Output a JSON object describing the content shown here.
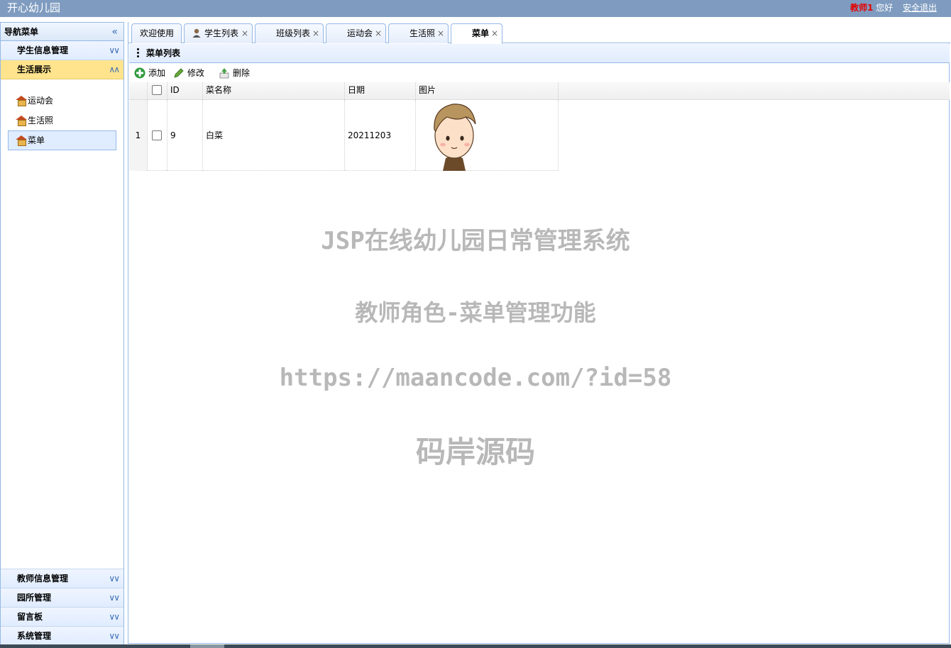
{
  "header": {
    "app_title": "开心幼儿园",
    "username": "教师1",
    "greeting": "您好",
    "logout": "安全退出"
  },
  "sidebar": {
    "title": "导航菜单",
    "groups_top": [
      {
        "label": "学生信息管理",
        "state": "collapsed"
      },
      {
        "label": "生活展示",
        "state": "expanded"
      }
    ],
    "items": [
      {
        "label": "运动会",
        "selected": false
      },
      {
        "label": "生活照",
        "selected": false
      },
      {
        "label": "菜单",
        "selected": true
      }
    ],
    "groups_bottom": [
      {
        "label": "教师信息管理"
      },
      {
        "label": "园所管理"
      },
      {
        "label": "留言板"
      },
      {
        "label": "系统管理"
      }
    ]
  },
  "tabs": [
    {
      "label": "欢迎使用",
      "closable": false,
      "icon": null
    },
    {
      "label": "学生列表",
      "closable": true,
      "icon": "user-icon"
    },
    {
      "label": "班级列表",
      "closable": true,
      "icon": null
    },
    {
      "label": "运动会",
      "closable": true,
      "icon": null
    },
    {
      "label": "生活照",
      "closable": true,
      "icon": null
    },
    {
      "label": "菜单",
      "closable": true,
      "icon": null,
      "active": true
    }
  ],
  "close_glyph": "×",
  "panel": {
    "title": "菜单列表"
  },
  "toolbar": {
    "add": "添加",
    "edit": "修改",
    "delete": "删除"
  },
  "table": {
    "columns": [
      "ID",
      "菜名称",
      "日期",
      "图片"
    ],
    "rows": [
      {
        "rownum": "1",
        "id": "9",
        "name": "白菜",
        "date": "20211203",
        "image": "cartoon-boy-avatar"
      }
    ]
  },
  "watermark": {
    "line1": "JSP在线幼儿园日常管理系统",
    "line2": "教师角色-菜单管理功能",
    "line3": "https://maancode.com/?id=58",
    "line4": "码岸源码"
  },
  "colors": {
    "header_bg": "#7f9cc0",
    "border": "#95b8e7",
    "active_group": "#ffe48d",
    "username": "#e60000",
    "watermark": "#b8b8b8"
  }
}
